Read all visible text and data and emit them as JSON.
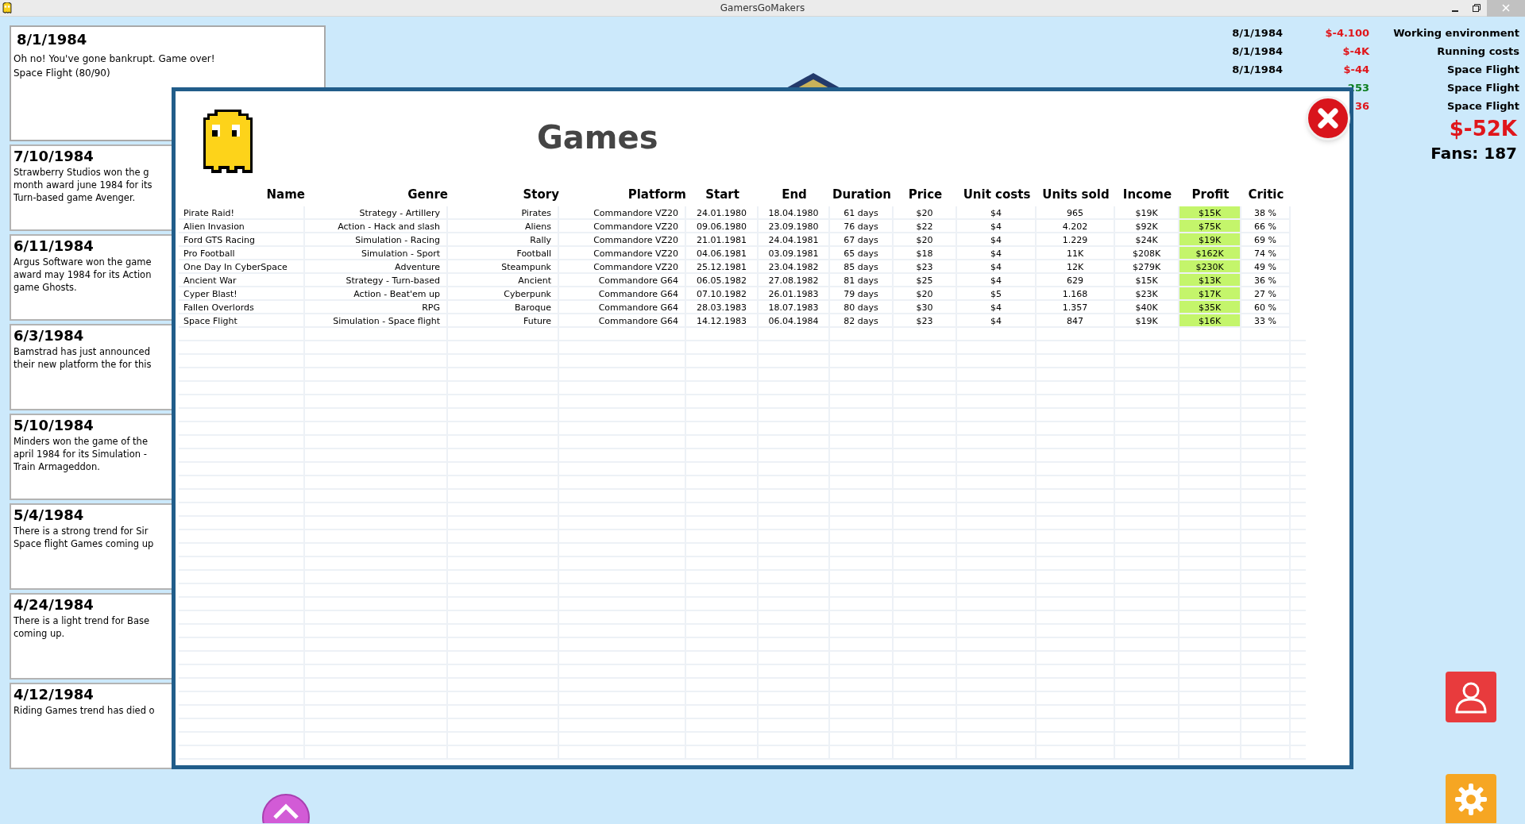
{
  "window": {
    "title": "GamersGoMakers"
  },
  "news": [
    {
      "date": "8/1/1984",
      "lines": [
        "Oh no! You've gone bankrupt. Game over!",
        "Space Flight (80/90)"
      ]
    },
    {
      "date": "7/10/1984",
      "lines": [
        "Strawberry Studios won the g",
        "month award june 1984 for its",
        "Turn-based game Avenger."
      ]
    },
    {
      "date": "6/11/1984",
      "lines": [
        "Argus Software won the game",
        "award may 1984 for its Action",
        "game Ghosts."
      ]
    },
    {
      "date": "6/3/1984",
      "lines": [
        "Bamstrad has just announced",
        "their new platform the for this"
      ]
    },
    {
      "date": "5/10/1984",
      "lines": [
        "Minders won the game of the",
        "april 1984 for its Simulation -",
        "Train Armageddon."
      ]
    },
    {
      "date": "5/4/1984",
      "lines": [
        "There is a strong trend for Sir",
        "Space flight Games coming up"
      ]
    },
    {
      "date": "4/24/1984",
      "lines": [
        "There is a light trend for Base",
        "coming up."
      ]
    },
    {
      "date": "4/12/1984",
      "lines": [
        "Riding Games trend has died o"
      ]
    }
  ],
  "ledger": [
    {
      "date": "8/1/1984",
      "amount": "$-4.100",
      "kind": "expense",
      "label": "Working environment"
    },
    {
      "date": "8/1/1984",
      "amount": "$-4K",
      "kind": "expense",
      "label": "Running costs"
    },
    {
      "date": "8/1/1984",
      "amount": "$-44",
      "kind": "expense",
      "label": "Space Flight"
    },
    {
      "amount": "253",
      "kind": "income",
      "label": "Space Flight"
    },
    {
      "amount": "36",
      "kind": "expense",
      "label": "Space Flight"
    }
  ],
  "balance": "$-52K",
  "fans": "Fans: 187",
  "games_dialog": {
    "title": "Games",
    "columns": [
      "Name",
      "Genre",
      "Story",
      "Platform",
      "Start",
      "End",
      "Duration",
      "Price",
      "Unit costs",
      "Units sold",
      "Income",
      "Profit",
      "Critic"
    ],
    "rows": [
      [
        "Pirate Raid!",
        "Strategy - Artillery",
        "Pirates",
        "Commandore VZ20",
        "24.01.1980",
        "18.04.1980",
        "61 days",
        "$20",
        "$4",
        "965",
        "$19K",
        "$15K",
        "38 %"
      ],
      [
        "Alien Invasion",
        "Action - Hack and slash",
        "Aliens",
        "Commandore VZ20",
        "09.06.1980",
        "23.09.1980",
        "76 days",
        "$22",
        "$4",
        "4.202",
        "$92K",
        "$75K",
        "66 %"
      ],
      [
        "Ford GTS Racing",
        "Simulation - Racing",
        "Rally",
        "Commandore VZ20",
        "21.01.1981",
        "24.04.1981",
        "67 days",
        "$20",
        "$4",
        "1.229",
        "$24K",
        "$19K",
        "69 %"
      ],
      [
        "Pro Football",
        "Simulation - Sport",
        "Football",
        "Commandore VZ20",
        "04.06.1981",
        "03.09.1981",
        "65 days",
        "$18",
        "$4",
        "11K",
        "$208K",
        "$162K",
        "74 %"
      ],
      [
        "One Day In CyberSpace",
        "Adventure",
        "Steampunk",
        "Commandore VZ20",
        "25.12.1981",
        "23.04.1982",
        "85 days",
        "$23",
        "$4",
        "12K",
        "$279K",
        "$230K",
        "49 %"
      ],
      [
        "Ancient War",
        "Strategy - Turn-based",
        "Ancient",
        "Commandore G64",
        "06.05.1982",
        "27.08.1982",
        "81 days",
        "$25",
        "$4",
        "629",
        "$15K",
        "$13K",
        "36 %"
      ],
      [
        "Cyper Blast!",
        "Action - Beat'em up",
        "Cyberpunk",
        "Commandore G64",
        "07.10.1982",
        "26.01.1983",
        "79 days",
        "$20",
        "$5",
        "1.168",
        "$23K",
        "$17K",
        "27 %"
      ],
      [
        "Fallen Overlords",
        "RPG",
        "Baroque",
        "Commandore G64",
        "28.03.1983",
        "18.07.1983",
        "80 days",
        "$30",
        "$4",
        "1.357",
        "$40K",
        "$35K",
        "60 %"
      ],
      [
        "Space Flight",
        "Simulation - Space flight",
        "Future",
        "Commandore G64",
        "14.12.1983",
        "06.04.1984",
        "82 days",
        "$23",
        "$4",
        "847",
        "$19K",
        "$16K",
        "33 %"
      ]
    ]
  }
}
